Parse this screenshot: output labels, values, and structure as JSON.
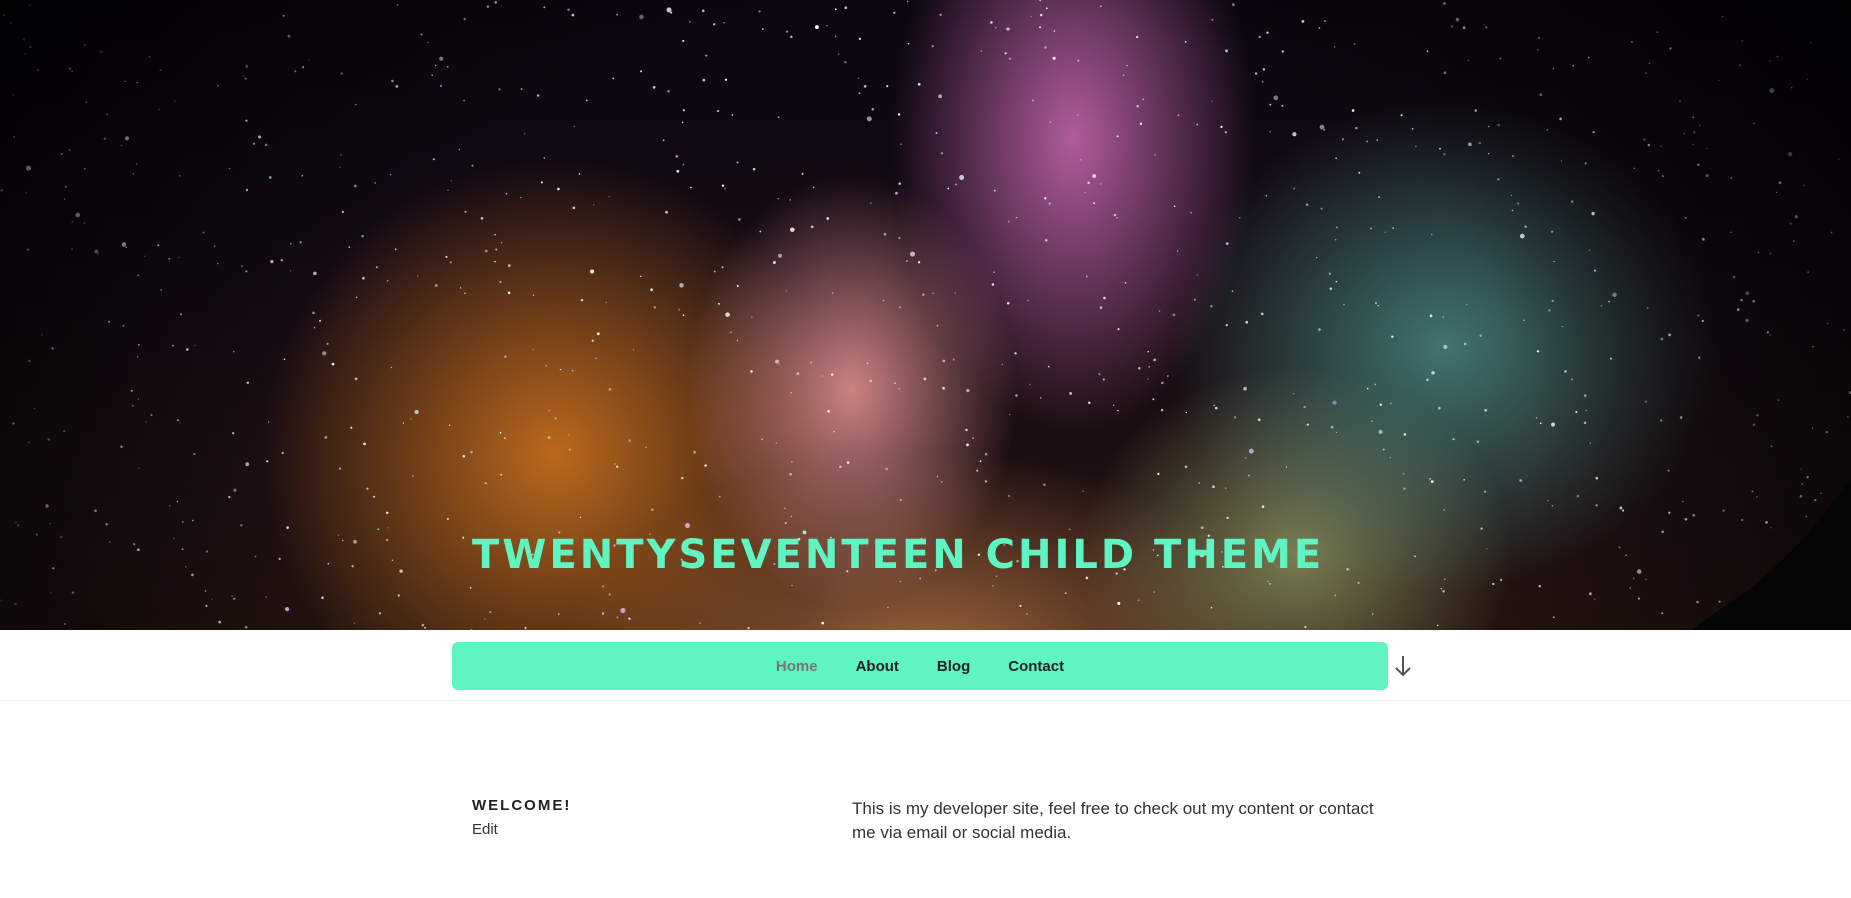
{
  "site": {
    "title": "TWENTYSEVENTEEN CHILD THEME"
  },
  "colors": {
    "accent": "#5ff5c2",
    "nav_text": "#222222",
    "nav_current": "#767676"
  },
  "nav": {
    "items": [
      {
        "label": "Home",
        "current": true
      },
      {
        "label": "About",
        "current": false
      },
      {
        "label": "Blog",
        "current": false
      },
      {
        "label": "Contact",
        "current": false
      }
    ],
    "scroll_icon": "arrow-down-icon"
  },
  "page": {
    "heading": "WELCOME!",
    "edit_label": "Edit",
    "body": "This is my developer site, feel free to check out my content or contact me via email or social media."
  }
}
